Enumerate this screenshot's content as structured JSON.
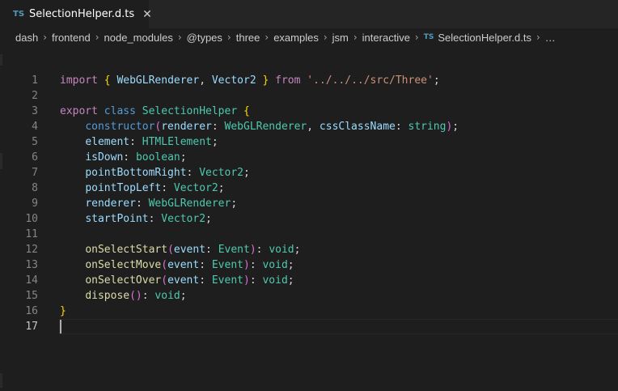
{
  "tab": {
    "badge": "TS",
    "title": "SelectionHelper.d.ts"
  },
  "breadcrumb": {
    "items": [
      "dash",
      "frontend",
      "node_modules",
      "@types",
      "three",
      "examples",
      "jsm",
      "interactive"
    ],
    "file_badge": "TS",
    "file": "SelectionHelper.d.ts",
    "ellipsis": "…"
  },
  "editor": {
    "active_line": 17,
    "line_numbers": [
      "1",
      "2",
      "3",
      "4",
      "5",
      "6",
      "7",
      "8",
      "9",
      "10",
      "11",
      "12",
      "13",
      "14",
      "15",
      "16",
      "17"
    ],
    "colors": {
      "background": "#1e1e1e",
      "keyword": "#c586c0",
      "storage": "#569cd6",
      "type": "#4ec9b0",
      "variable": "#9cdcfe",
      "function": "#dcdcaa",
      "string": "#ce9178",
      "bracket1": "#ffd700",
      "bracket2": "#da70d6"
    },
    "lines": [
      [
        [
          "k",
          "import"
        ],
        [
          "p",
          " "
        ],
        [
          "b1",
          "{"
        ],
        [
          "p",
          " "
        ],
        [
          "v",
          "WebGLRenderer"
        ],
        [
          "p",
          ", "
        ],
        [
          "v",
          "Vector2"
        ],
        [
          "p",
          " "
        ],
        [
          "b1",
          "}"
        ],
        [
          "p",
          " "
        ],
        [
          "k",
          "from"
        ],
        [
          "p",
          " "
        ],
        [
          "s",
          "'../../../src/Three'"
        ],
        [
          "p",
          ";"
        ]
      ],
      [],
      [
        [
          "k",
          "export"
        ],
        [
          "p",
          " "
        ],
        [
          "kb",
          "class"
        ],
        [
          "p",
          " "
        ],
        [
          "c",
          "SelectionHelper"
        ],
        [
          "p",
          " "
        ],
        [
          "b1",
          "{"
        ]
      ],
      [
        [
          "p",
          "    "
        ],
        [
          "kb",
          "constructor"
        ],
        [
          "b2",
          "("
        ],
        [
          "v",
          "renderer"
        ],
        [
          "p",
          ": "
        ],
        [
          "c",
          "WebGLRenderer"
        ],
        [
          "p",
          ", "
        ],
        [
          "v",
          "cssClassName"
        ],
        [
          "p",
          ": "
        ],
        [
          "c",
          "string"
        ],
        [
          "b2",
          ")"
        ],
        [
          "p",
          ";"
        ]
      ],
      [
        [
          "p",
          "    "
        ],
        [
          "v",
          "element"
        ],
        [
          "p",
          ": "
        ],
        [
          "c",
          "HTMLElement"
        ],
        [
          "p",
          ";"
        ]
      ],
      [
        [
          "p",
          "    "
        ],
        [
          "v",
          "isDown"
        ],
        [
          "p",
          ": "
        ],
        [
          "c",
          "boolean"
        ],
        [
          "p",
          ";"
        ]
      ],
      [
        [
          "p",
          "    "
        ],
        [
          "v",
          "pointBottomRight"
        ],
        [
          "p",
          ": "
        ],
        [
          "c",
          "Vector2"
        ],
        [
          "p",
          ";"
        ]
      ],
      [
        [
          "p",
          "    "
        ],
        [
          "v",
          "pointTopLeft"
        ],
        [
          "p",
          ": "
        ],
        [
          "c",
          "Vector2"
        ],
        [
          "p",
          ";"
        ]
      ],
      [
        [
          "p",
          "    "
        ],
        [
          "v",
          "renderer"
        ],
        [
          "p",
          ": "
        ],
        [
          "c",
          "WebGLRenderer"
        ],
        [
          "p",
          ";"
        ]
      ],
      [
        [
          "p",
          "    "
        ],
        [
          "v",
          "startPoint"
        ],
        [
          "p",
          ": "
        ],
        [
          "c",
          "Vector2"
        ],
        [
          "p",
          ";"
        ]
      ],
      [],
      [
        [
          "p",
          "    "
        ],
        [
          "fn",
          "onSelectStart"
        ],
        [
          "b2",
          "("
        ],
        [
          "v",
          "event"
        ],
        [
          "p",
          ": "
        ],
        [
          "c",
          "Event"
        ],
        [
          "b2",
          ")"
        ],
        [
          "p",
          ": "
        ],
        [
          "c",
          "void"
        ],
        [
          "p",
          ";"
        ]
      ],
      [
        [
          "p",
          "    "
        ],
        [
          "fn",
          "onSelectMove"
        ],
        [
          "b2",
          "("
        ],
        [
          "v",
          "event"
        ],
        [
          "p",
          ": "
        ],
        [
          "c",
          "Event"
        ],
        [
          "b2",
          ")"
        ],
        [
          "p",
          ": "
        ],
        [
          "c",
          "void"
        ],
        [
          "p",
          ";"
        ]
      ],
      [
        [
          "p",
          "    "
        ],
        [
          "fn",
          "onSelectOver"
        ],
        [
          "b2",
          "("
        ],
        [
          "v",
          "event"
        ],
        [
          "p",
          ": "
        ],
        [
          "c",
          "Event"
        ],
        [
          "b2",
          ")"
        ],
        [
          "p",
          ": "
        ],
        [
          "c",
          "void"
        ],
        [
          "p",
          ";"
        ]
      ],
      [
        [
          "p",
          "    "
        ],
        [
          "fn",
          "dispose"
        ],
        [
          "b2",
          "()"
        ],
        [
          "p",
          ": "
        ],
        [
          "c",
          "void"
        ],
        [
          "p",
          ";"
        ]
      ],
      [
        [
          "b1",
          "}"
        ]
      ],
      []
    ]
  }
}
